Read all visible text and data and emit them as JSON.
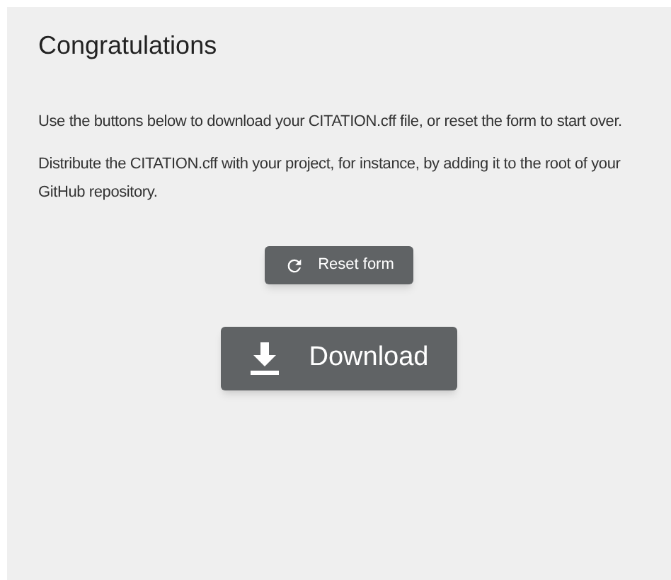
{
  "title": "Congratulations",
  "paragraphs": [
    "Use the buttons below to download your CITATION.cff file, or reset the form to start over.",
    "Distribute the CITATION.cff with your project, for instance, by adding it to the root of your GitHub repository."
  ],
  "buttons": [
    {
      "kind": "reset",
      "label": "Reset form"
    },
    {
      "kind": "download",
      "label": "Download"
    }
  ]
}
